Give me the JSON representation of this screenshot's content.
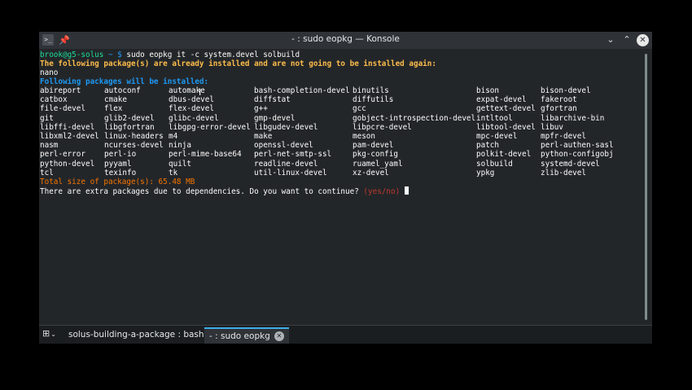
{
  "window": {
    "title": "- : sudo eopkg — Konsole",
    "app_icon": ">_",
    "pin_icon": "📌",
    "minimize_glyph": "⌄",
    "maximize_glyph": "⌃",
    "close_glyph": "✕"
  },
  "terminal": {
    "prompt_user": "brook@g5-solus",
    "prompt_path": " ~ $ ",
    "command": "sudo eopkg it -c system.devel solbuild",
    "already_installed_msg": "The following package(s) are already installed and are not going to be installed again:",
    "already_installed_pkg": "nano",
    "following_msg": "Following packages will be installed:",
    "packages": [
      [
        "abireport",
        "autoconf",
        "automake",
        "bash-completion-devel",
        "binutils",
        "bison",
        "bison-devel"
      ],
      [
        "catbox",
        "cmake",
        "dbus-devel",
        "diffstat",
        "diffutils",
        "expat-devel",
        "fakeroot"
      ],
      [
        "file-devel",
        "flex",
        "flex-devel",
        "g++",
        "gcc",
        "gettext-devel",
        "gfortran"
      ],
      [
        "git",
        "glib2-devel",
        "glibc-devel",
        "gmp-devel",
        "gobject-introspection-devel",
        "intltool",
        "libarchive-bin"
      ],
      [
        "libffi-devel",
        "libgfortran",
        "libgpg-error-devel",
        "libgudev-devel",
        "libpcre-devel",
        "libtool-devel",
        "libuv"
      ],
      [
        "libxml2-devel",
        "linux-headers",
        "m4",
        "make",
        "meson",
        "mpc-devel",
        "mpfr-devel"
      ],
      [
        "nasm",
        "ncurses-devel",
        "ninja",
        "openssl-devel",
        "pam-devel",
        "patch",
        "perl-authen-sasl"
      ],
      [
        "perl-error",
        "perl-io",
        "perl-mime-base64",
        "perl-net-smtp-ssl",
        "pkg-config",
        "polkit-devel",
        "python-configobj"
      ],
      [
        "python-devel",
        "pyyaml",
        "quilt",
        "readline-devel",
        "ruamel_yaml",
        "solbuild",
        "systemd-devel"
      ],
      [
        "tcl",
        "texinfo",
        "tk",
        "util-linux-devel",
        "xz-devel",
        "ypkg",
        "zlib-devel"
      ]
    ],
    "total_size": "Total size of package(s): 65.48 MB",
    "question": "There are extra packages due to dependencies. Do you want to continue? ",
    "question_choice": "(yes/no)"
  },
  "tabs": [
    {
      "label": "solus-building-a-package : bash",
      "active": false
    },
    {
      "label": "- : sudo eopkg",
      "active": true
    }
  ],
  "colors": {
    "prompt_green": "#1cdc9a",
    "prompt_path_blue": "#1d99f3",
    "warning_yellow": "#fdbc4b",
    "info_blue": "#1d99f3",
    "total_orange": "#f67400",
    "question_red": "#c0392b"
  }
}
